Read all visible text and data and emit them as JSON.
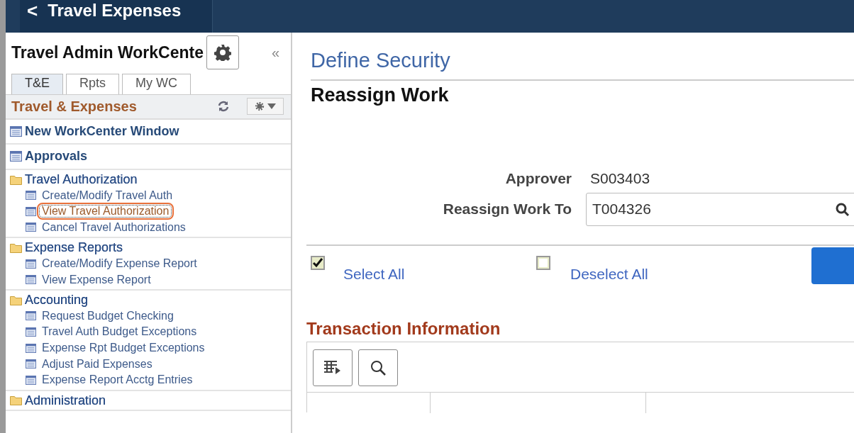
{
  "header": {
    "back_icon": "<",
    "title": "Travel Expenses"
  },
  "sidebar": {
    "title": "Travel Admin WorkCente",
    "collapse_icon": "«",
    "tabs": [
      {
        "label": "T&E",
        "selected": true
      },
      {
        "label": "Rpts",
        "selected": false
      },
      {
        "label": "My WC",
        "selected": false
      }
    ],
    "section_title": "Travel & Expenses",
    "groups": [
      {
        "kind": "page",
        "label": "New WorkCenter Window"
      },
      {
        "kind": "page",
        "label": "Approvals"
      },
      {
        "kind": "folder",
        "label": "Travel Authorization",
        "children": [
          {
            "label": "Create/Modify Travel Auth",
            "highlighted": false
          },
          {
            "label": "View Travel Authorization",
            "highlighted": true
          },
          {
            "label": "Cancel Travel Authorizations",
            "highlighted": false
          }
        ]
      },
      {
        "kind": "folder",
        "label": "Expense Reports",
        "children": [
          {
            "label": "Create/Modify Expense Report",
            "highlighted": false
          },
          {
            "label": "View Expense Report",
            "highlighted": false
          }
        ]
      },
      {
        "kind": "folder",
        "label": "Accounting",
        "children": [
          {
            "label": "Request Budget Checking",
            "highlighted": false
          },
          {
            "label": "Travel Auth Budget Exceptions",
            "highlighted": false
          },
          {
            "label": "Expense Rpt Budget Exceptions",
            "highlighted": false
          },
          {
            "label": "Adjust Paid Expenses",
            "highlighted": false
          },
          {
            "label": "Expense Report Acctg Entries",
            "highlighted": false
          }
        ]
      },
      {
        "kind": "folder",
        "label": "Administration"
      }
    ]
  },
  "main": {
    "breadcrumb": "Define Security",
    "title": "Reassign Work",
    "approver": {
      "label": "Approver",
      "value": "S003403"
    },
    "reassign": {
      "label": "Reassign Work To",
      "value": "T004326"
    },
    "checks": [
      {
        "label": "Select All",
        "checked": true
      },
      {
        "label": "Deselect All",
        "checked": false
      }
    ],
    "section": "Transaction Information"
  }
}
